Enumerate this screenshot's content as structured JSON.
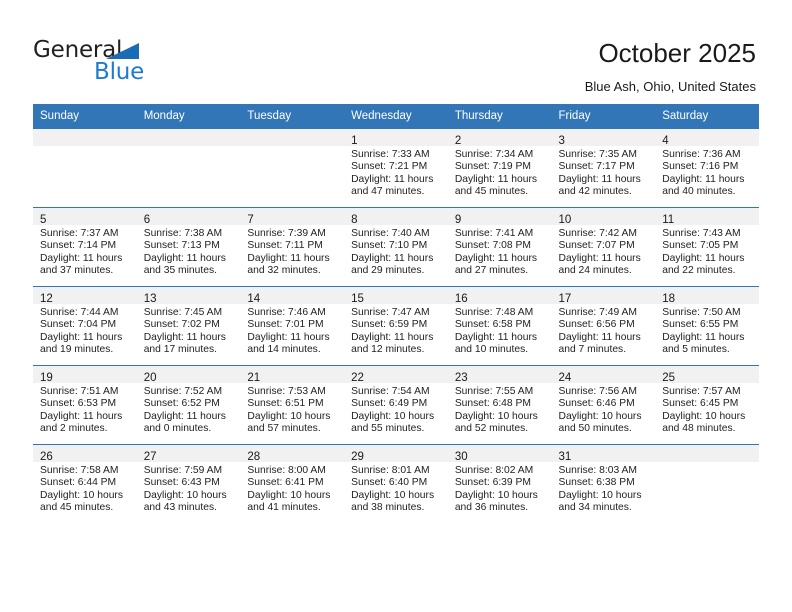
{
  "brand": {
    "name_part1": "General",
    "name_part2": "Blue",
    "accent_color": "#1b7bd1",
    "triangle_color": "#1b6cb5"
  },
  "header": {
    "title": "October 2025",
    "subtitle": "Blue Ash, Ohio, United States"
  },
  "theme": {
    "header_row_bg": "#3276b8",
    "daynum_band_bg": "#f1f1f1",
    "grid_line": "#3276b8",
    "text": "#1a1a1a"
  },
  "weekday_headers": [
    "Sunday",
    "Monday",
    "Tuesday",
    "Wednesday",
    "Thursday",
    "Friday",
    "Saturday"
  ],
  "weeks": [
    [
      {
        "day": "",
        "sunrise": "",
        "sunset": "",
        "daylight_line1": "",
        "daylight_line2": ""
      },
      {
        "day": "",
        "sunrise": "",
        "sunset": "",
        "daylight_line1": "",
        "daylight_line2": ""
      },
      {
        "day": "",
        "sunrise": "",
        "sunset": "",
        "daylight_line1": "",
        "daylight_line2": ""
      },
      {
        "day": "1",
        "sunrise": "Sunrise: 7:33 AM",
        "sunset": "Sunset: 7:21 PM",
        "daylight_line1": "Daylight: 11 hours",
        "daylight_line2": "and 47 minutes."
      },
      {
        "day": "2",
        "sunrise": "Sunrise: 7:34 AM",
        "sunset": "Sunset: 7:19 PM",
        "daylight_line1": "Daylight: 11 hours",
        "daylight_line2": "and 45 minutes."
      },
      {
        "day": "3",
        "sunrise": "Sunrise: 7:35 AM",
        "sunset": "Sunset: 7:17 PM",
        "daylight_line1": "Daylight: 11 hours",
        "daylight_line2": "and 42 minutes."
      },
      {
        "day": "4",
        "sunrise": "Sunrise: 7:36 AM",
        "sunset": "Sunset: 7:16 PM",
        "daylight_line1": "Daylight: 11 hours",
        "daylight_line2": "and 40 minutes."
      }
    ],
    [
      {
        "day": "5",
        "sunrise": "Sunrise: 7:37 AM",
        "sunset": "Sunset: 7:14 PM",
        "daylight_line1": "Daylight: 11 hours",
        "daylight_line2": "and 37 minutes."
      },
      {
        "day": "6",
        "sunrise": "Sunrise: 7:38 AM",
        "sunset": "Sunset: 7:13 PM",
        "daylight_line1": "Daylight: 11 hours",
        "daylight_line2": "and 35 minutes."
      },
      {
        "day": "7",
        "sunrise": "Sunrise: 7:39 AM",
        "sunset": "Sunset: 7:11 PM",
        "daylight_line1": "Daylight: 11 hours",
        "daylight_line2": "and 32 minutes."
      },
      {
        "day": "8",
        "sunrise": "Sunrise: 7:40 AM",
        "sunset": "Sunset: 7:10 PM",
        "daylight_line1": "Daylight: 11 hours",
        "daylight_line2": "and 29 minutes."
      },
      {
        "day": "9",
        "sunrise": "Sunrise: 7:41 AM",
        "sunset": "Sunset: 7:08 PM",
        "daylight_line1": "Daylight: 11 hours",
        "daylight_line2": "and 27 minutes."
      },
      {
        "day": "10",
        "sunrise": "Sunrise: 7:42 AM",
        "sunset": "Sunset: 7:07 PM",
        "daylight_line1": "Daylight: 11 hours",
        "daylight_line2": "and 24 minutes."
      },
      {
        "day": "11",
        "sunrise": "Sunrise: 7:43 AM",
        "sunset": "Sunset: 7:05 PM",
        "daylight_line1": "Daylight: 11 hours",
        "daylight_line2": "and 22 minutes."
      }
    ],
    [
      {
        "day": "12",
        "sunrise": "Sunrise: 7:44 AM",
        "sunset": "Sunset: 7:04 PM",
        "daylight_line1": "Daylight: 11 hours",
        "daylight_line2": "and 19 minutes."
      },
      {
        "day": "13",
        "sunrise": "Sunrise: 7:45 AM",
        "sunset": "Sunset: 7:02 PM",
        "daylight_line1": "Daylight: 11 hours",
        "daylight_line2": "and 17 minutes."
      },
      {
        "day": "14",
        "sunrise": "Sunrise: 7:46 AM",
        "sunset": "Sunset: 7:01 PM",
        "daylight_line1": "Daylight: 11 hours",
        "daylight_line2": "and 14 minutes."
      },
      {
        "day": "15",
        "sunrise": "Sunrise: 7:47 AM",
        "sunset": "Sunset: 6:59 PM",
        "daylight_line1": "Daylight: 11 hours",
        "daylight_line2": "and 12 minutes."
      },
      {
        "day": "16",
        "sunrise": "Sunrise: 7:48 AM",
        "sunset": "Sunset: 6:58 PM",
        "daylight_line1": "Daylight: 11 hours",
        "daylight_line2": "and 10 minutes."
      },
      {
        "day": "17",
        "sunrise": "Sunrise: 7:49 AM",
        "sunset": "Sunset: 6:56 PM",
        "daylight_line1": "Daylight: 11 hours",
        "daylight_line2": "and 7 minutes."
      },
      {
        "day": "18",
        "sunrise": "Sunrise: 7:50 AM",
        "sunset": "Sunset: 6:55 PM",
        "daylight_line1": "Daylight: 11 hours",
        "daylight_line2": "and 5 minutes."
      }
    ],
    [
      {
        "day": "19",
        "sunrise": "Sunrise: 7:51 AM",
        "sunset": "Sunset: 6:53 PM",
        "daylight_line1": "Daylight: 11 hours",
        "daylight_line2": "and 2 minutes."
      },
      {
        "day": "20",
        "sunrise": "Sunrise: 7:52 AM",
        "sunset": "Sunset: 6:52 PM",
        "daylight_line1": "Daylight: 11 hours",
        "daylight_line2": "and 0 minutes."
      },
      {
        "day": "21",
        "sunrise": "Sunrise: 7:53 AM",
        "sunset": "Sunset: 6:51 PM",
        "daylight_line1": "Daylight: 10 hours",
        "daylight_line2": "and 57 minutes."
      },
      {
        "day": "22",
        "sunrise": "Sunrise: 7:54 AM",
        "sunset": "Sunset: 6:49 PM",
        "daylight_line1": "Daylight: 10 hours",
        "daylight_line2": "and 55 minutes."
      },
      {
        "day": "23",
        "sunrise": "Sunrise: 7:55 AM",
        "sunset": "Sunset: 6:48 PM",
        "daylight_line1": "Daylight: 10 hours",
        "daylight_line2": "and 52 minutes."
      },
      {
        "day": "24",
        "sunrise": "Sunrise: 7:56 AM",
        "sunset": "Sunset: 6:46 PM",
        "daylight_line1": "Daylight: 10 hours",
        "daylight_line2": "and 50 minutes."
      },
      {
        "day": "25",
        "sunrise": "Sunrise: 7:57 AM",
        "sunset": "Sunset: 6:45 PM",
        "daylight_line1": "Daylight: 10 hours",
        "daylight_line2": "and 48 minutes."
      }
    ],
    [
      {
        "day": "26",
        "sunrise": "Sunrise: 7:58 AM",
        "sunset": "Sunset: 6:44 PM",
        "daylight_line1": "Daylight: 10 hours",
        "daylight_line2": "and 45 minutes."
      },
      {
        "day": "27",
        "sunrise": "Sunrise: 7:59 AM",
        "sunset": "Sunset: 6:43 PM",
        "daylight_line1": "Daylight: 10 hours",
        "daylight_line2": "and 43 minutes."
      },
      {
        "day": "28",
        "sunrise": "Sunrise: 8:00 AM",
        "sunset": "Sunset: 6:41 PM",
        "daylight_line1": "Daylight: 10 hours",
        "daylight_line2": "and 41 minutes."
      },
      {
        "day": "29",
        "sunrise": "Sunrise: 8:01 AM",
        "sunset": "Sunset: 6:40 PM",
        "daylight_line1": "Daylight: 10 hours",
        "daylight_line2": "and 38 minutes."
      },
      {
        "day": "30",
        "sunrise": "Sunrise: 8:02 AM",
        "sunset": "Sunset: 6:39 PM",
        "daylight_line1": "Daylight: 10 hours",
        "daylight_line2": "and 36 minutes."
      },
      {
        "day": "31",
        "sunrise": "Sunrise: 8:03 AM",
        "sunset": "Sunset: 6:38 PM",
        "daylight_line1": "Daylight: 10 hours",
        "daylight_line2": "and 34 minutes."
      },
      {
        "day": "",
        "sunrise": "",
        "sunset": "",
        "daylight_line1": "",
        "daylight_line2": ""
      }
    ]
  ]
}
